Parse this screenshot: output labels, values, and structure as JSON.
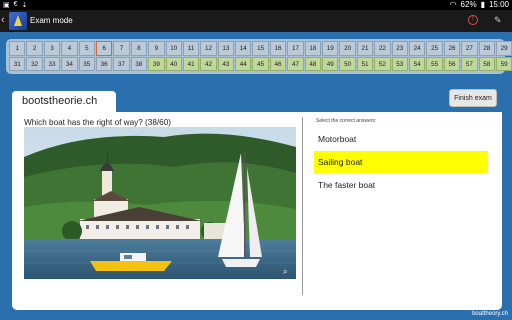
{
  "statusbar": {
    "left_icons": [
      "image-icon",
      "euro-icon",
      "download-icon"
    ],
    "battery": "62%",
    "time": "15:00"
  },
  "actionbar": {
    "title": "Exam mode"
  },
  "grid": {
    "current": 6,
    "answered_from": 39,
    "answered_to": 60,
    "total": 60
  },
  "panel": {
    "site": "bootstheorie.ch",
    "finish_label": "Finish exam",
    "question": "Which boat has the right of way? (38/60)",
    "prompt": "Select the correct answers:",
    "answers": [
      "Motorboat",
      "Sailing boat",
      "The faster boat"
    ],
    "selected_index": 1
  },
  "footer": "boattheory.ch",
  "colors": {
    "background": "#2a6fae",
    "answered_cell": "#bfd79a",
    "current_cell_border": "#d6653b",
    "highlight": "#ffff00"
  }
}
